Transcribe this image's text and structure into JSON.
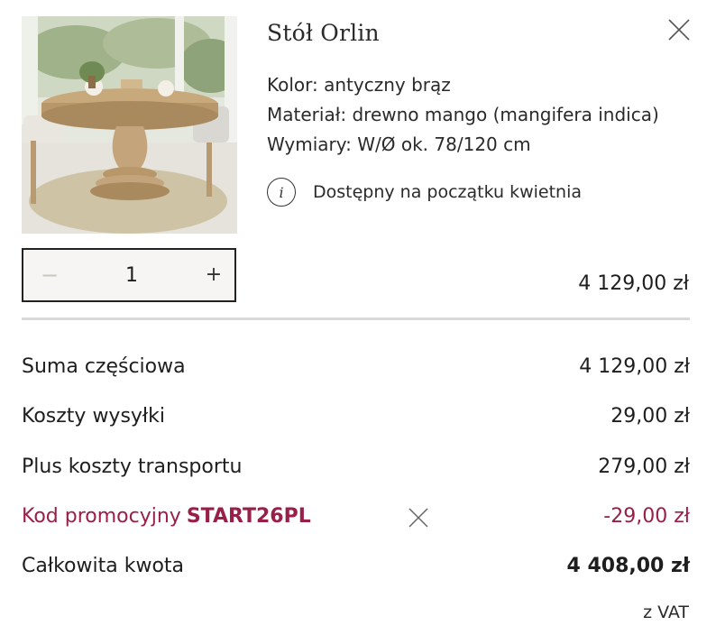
{
  "product": {
    "title": "Stół Orlin",
    "attributes": [
      "Kolor: antyczny brąz",
      "Materiał: drewno mango (mangifera indica)",
      "Wymiary: W/Ø ok. 78/120 cm"
    ],
    "availability": "Dostępny na początku kwietnia",
    "info_icon": "i",
    "image_icon": "round-pedestal-table-photo"
  },
  "quantity": {
    "minus": "−",
    "value": "1",
    "plus": "+"
  },
  "line_price": "4 129,00 zł",
  "summary": {
    "subtotal_label": "Suma częściowa",
    "subtotal_value": "4 129,00 zł",
    "shipping_label": "Koszty wysyłki",
    "shipping_value": "29,00 zł",
    "transport_label": "Plus koszty transportu",
    "transport_value": "279,00 zł",
    "promo_label": "Kod promocyjny",
    "promo_code": "START26PL",
    "promo_value": "-29,00 zł",
    "total_label": "Całkowita kwota",
    "total_value": "4 408,00 zł",
    "vat_note": "z VAT"
  },
  "colors": {
    "promo_accent": "#9a1f48",
    "divider": "#d9d9d9",
    "text": "#1e1e1e"
  }
}
